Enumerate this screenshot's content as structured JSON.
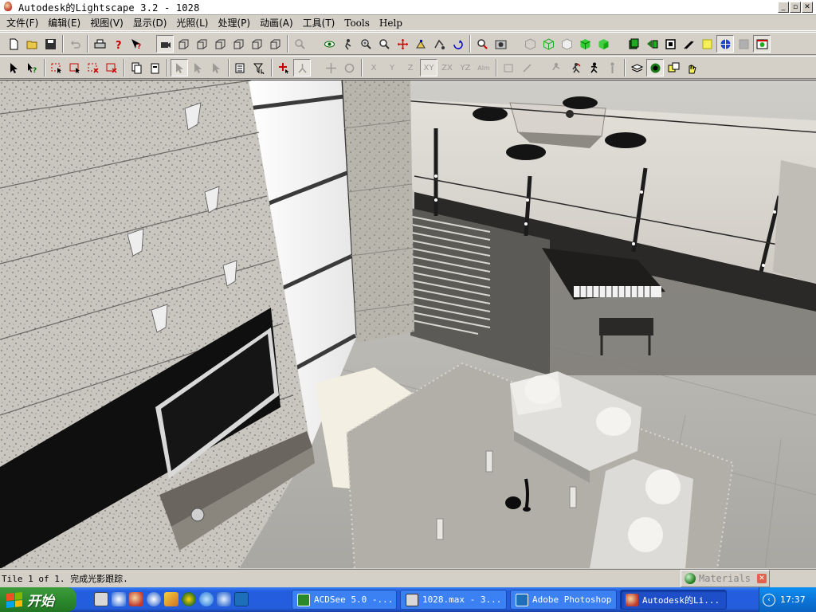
{
  "window": {
    "title": "Autodesk的Lightscape 3.2  - 1028",
    "buttons": {
      "minimize": "_",
      "maximize": "▫",
      "close": "✕"
    }
  },
  "menu": [
    {
      "label": "文件(F)"
    },
    {
      "label": "编辑(E)"
    },
    {
      "label": "视图(V)"
    },
    {
      "label": "显示(D)"
    },
    {
      "label": "光照(L)"
    },
    {
      "label": "处理(P)"
    },
    {
      "label": "动画(A)"
    },
    {
      "label": "工具(T)"
    },
    {
      "label": "Tools"
    },
    {
      "label": "Help"
    }
  ],
  "toolbar2_axes": [
    "X",
    "Y",
    "Z",
    "XY",
    "ZX",
    "YZ",
    "Alm"
  ],
  "status": {
    "text": "Tile 1 of 1. 完成光影跟踪."
  },
  "materials_panel": {
    "label": "Materials",
    "close": "✕"
  },
  "taskbar": {
    "start_label": "开始",
    "tasks": [
      {
        "label": "ACDSee 5.0 -..."
      },
      {
        "label": "1028.max - 3..."
      },
      {
        "label": "Adobe Photoshop"
      },
      {
        "label": "Autodesk的Li..."
      }
    ],
    "clock": "17:37",
    "tray_arrow": "‹"
  },
  "colors": {
    "chrome": "#d4d0c8",
    "taskbar_blue": "#245edc",
    "start_green": "#2d8b2d",
    "tray_blue": "#0b75d8"
  }
}
